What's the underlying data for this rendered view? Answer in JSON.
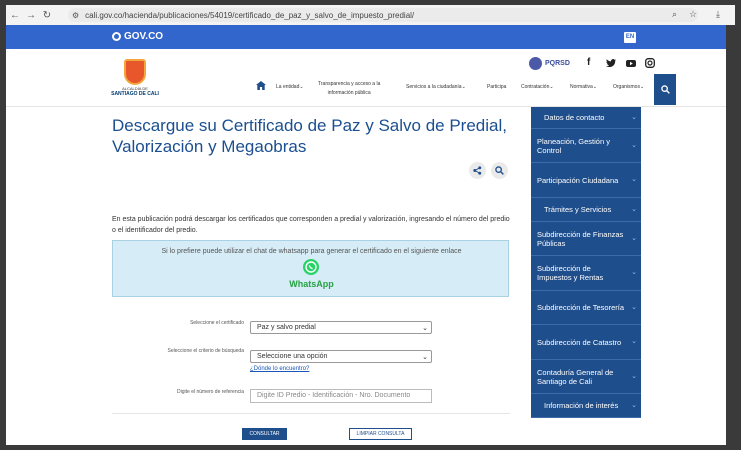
{
  "browser": {
    "url": "cali.gov.co/hacienda/publicaciones/54019/certificado_de_paz_y_salvo_de_impuesto_predial/"
  },
  "govbar": {
    "logo": "GOV.CO",
    "lang": "EN"
  },
  "header": {
    "brand_line1": "ALCALDÍA DE",
    "brand_line2": "SANTIAGO DE CALI",
    "pqrsd": "PQRSD",
    "menu": {
      "item1": "La entidad",
      "item2_l1": "Transparencia y acceso a la",
      "item2_l2": "información pública",
      "item3": "Servicios a la ciudadanía",
      "item4": "Participa",
      "item5": "Contratación",
      "item6": "Normativa",
      "item7": "Organismos"
    }
  },
  "main": {
    "title": "Descargue su Certificado de Paz y Salvo de Predial, Valorización y Megaobras",
    "intro": "En esta publicación podrá descargar los certificados que corresponden a predial y valorización, ingresando el número del predio o el identificador del predio.",
    "whatsapp_text": "Si lo prefiere puede utilizar el chat de whatsapp para generar el certificado en el siguiente enlace",
    "whatsapp_label": "WhatsApp"
  },
  "form": {
    "label_cert": "Seleccione el certificado",
    "cert_value": "Paz y salvo predial",
    "label_criterio": "Seleccione el criterio de búsqueda",
    "criterio_value": "Seleccione una opción",
    "help_link": "¿Dónde lo encuentro?",
    "label_number": "Digite el número de referencia",
    "number_placeholder": "Digite ID Predio - Identificación - Nro. Documento",
    "submit": "CONSULTAR",
    "clear": "LIMPIAR CONSULTA"
  },
  "sidebar": {
    "items": [
      {
        "label": "Datos de contacto"
      },
      {
        "label": "Planeación, Gestión y Control"
      },
      {
        "label": "Participación Ciudadana"
      },
      {
        "label": "Trámites y Servicios"
      },
      {
        "label": "Subdirección de Finanzas Públicas"
      },
      {
        "label": "Subdirección de Impuestos y Rentas"
      },
      {
        "label": "Subdirección de Tesorería"
      },
      {
        "label": "Subdirección de Catastro"
      },
      {
        "label": "Contaduría General de Santiago de Cali"
      },
      {
        "label": "Información de interés"
      }
    ]
  },
  "colors": {
    "govbar": "#3366cc",
    "primary": "#1f4e8c",
    "whatsapp": "#25d366"
  }
}
